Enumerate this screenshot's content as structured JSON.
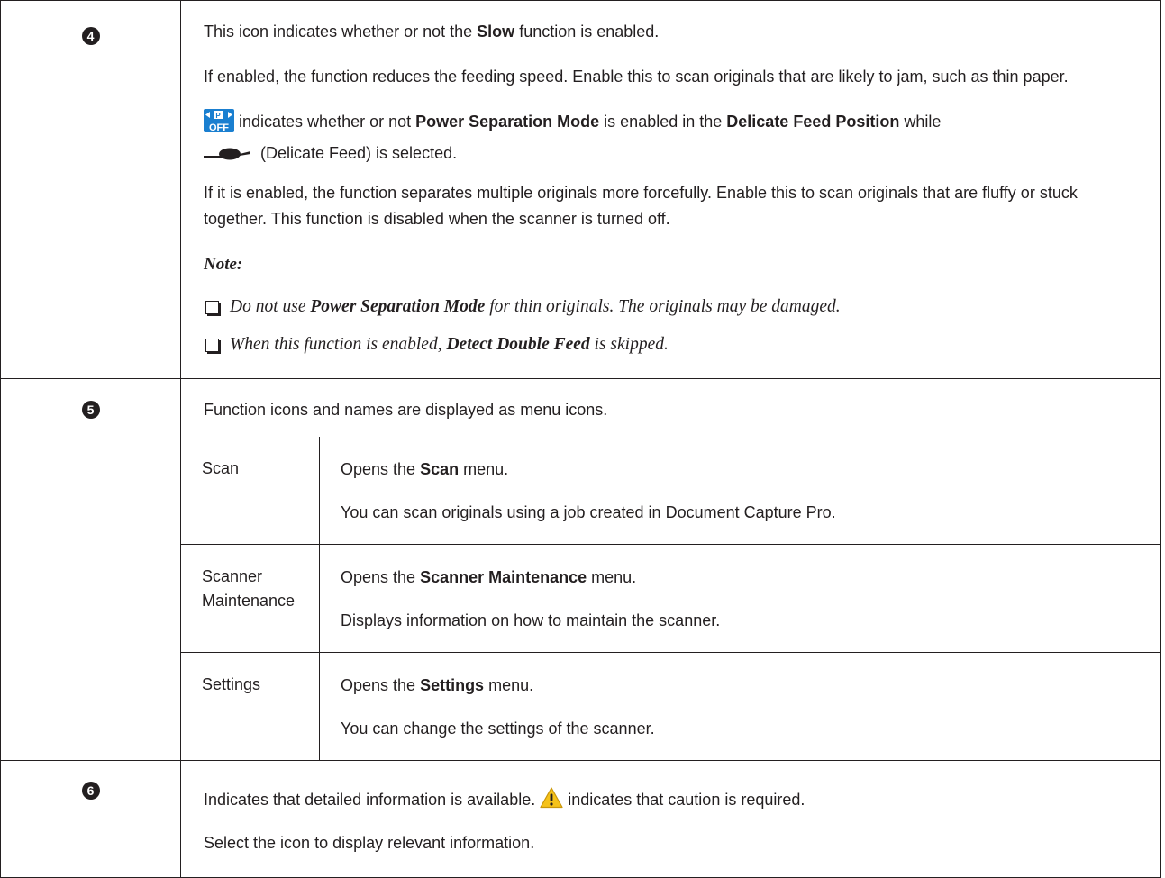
{
  "rows": [
    {
      "number": "4",
      "intro": {
        "before": "This icon indicates whether or not the ",
        "bold": "Slow",
        "after": " function is enabled."
      },
      "slow_detail": "If enabled, the function reduces the feeding speed. Enable this to scan originals that are likely to jam, such as thin paper.",
      "power_sep": {
        "icon_name": "power-separation-off-icon",
        "icon_text": "OFF",
        "t1": " indicates whether or not ",
        "b1": "Power Separation Mode",
        "t2": " is enabled in the ",
        "b2": "Delicate Feed Position",
        "t3": " while",
        "feed_icon_name": "delicate-feed-icon",
        "t4": " (Delicate Feed) is selected."
      },
      "enabled_detail": "If it is enabled, the function separates multiple originals more forcefully. Enable this to scan originals that are fluffy or stuck together. This function is disabled when the scanner is turned off.",
      "note": {
        "heading": "Note:",
        "items": [
          {
            "pre": "Do not use ",
            "bold": "Power Separation Mode",
            "post": " for thin originals. The originals may be damaged."
          },
          {
            "pre": "When this function is enabled, ",
            "bold": "Detect Double Feed",
            "post": " is skipped."
          }
        ]
      }
    },
    {
      "number": "5",
      "intro": "Function icons and names are displayed as menu icons.",
      "menu_items": [
        {
          "name": "Scan",
          "line1_pre": "Opens the ",
          "line1_bold": "Scan",
          "line1_post": " menu.",
          "line2": "You can scan originals using a job created in Document Capture Pro."
        },
        {
          "name": "Scanner Maintenance",
          "line1_pre": "Opens the ",
          "line1_bold": "Scanner Maintenance",
          "line1_post": " menu.",
          "line2": "Displays information on how to maintain the scanner."
        },
        {
          "name": "Settings",
          "line1_pre": "Opens the ",
          "line1_bold": "Settings",
          "line1_post": " menu.",
          "line2": "You can change the settings of the scanner."
        }
      ]
    },
    {
      "number": "6",
      "line1_pre": "Indicates that detailed information is available. ",
      "warning_icon_name": "warning-triangle-icon",
      "line1_post": " indicates that caution is required.",
      "line2": "Select the icon to display relevant information."
    }
  ],
  "colors": {
    "text": "#231f20",
    "icon_blue": "#1a7fd0",
    "warning_yellow": "#f5c21a"
  }
}
